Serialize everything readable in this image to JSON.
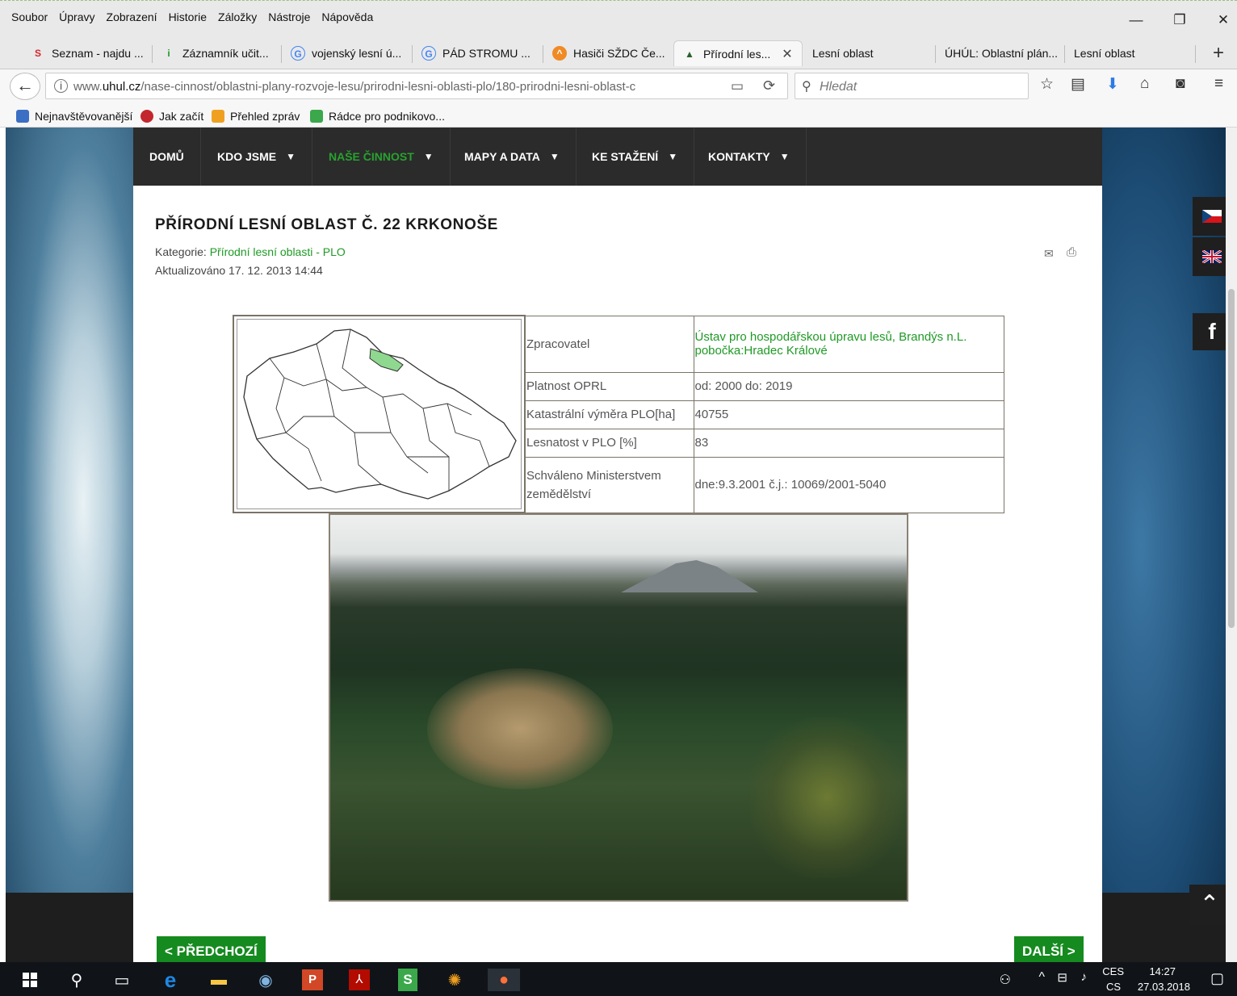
{
  "menubar": {
    "items": [
      "Soubor",
      "Úpravy",
      "Zobrazení",
      "Historie",
      "Záložky",
      "Nástroje",
      "Nápověda"
    ]
  },
  "tabs": [
    {
      "label": "Seznam - najdu ...",
      "icon": "seznam-icon",
      "color": "#d9262f",
      "glyph": "S"
    },
    {
      "label": "Záznamník učit...",
      "icon": "zaznamnik-icon",
      "color": "#1e9c2e",
      "glyph": "i"
    },
    {
      "label": "vojenský lesní ú...",
      "icon": "google-icon",
      "color": "#4285f4",
      "glyph": "G"
    },
    {
      "label": "PÁD STROMU ...",
      "icon": "google-icon",
      "color": "#4285f4",
      "glyph": "G"
    },
    {
      "label": "Hasiči SŽDC Če...",
      "icon": "fire-icon",
      "color": "#f08a24",
      "glyph": "^"
    },
    {
      "label": "Přírodní les...",
      "icon": "tree-icon",
      "color": "#2c5f2d",
      "glyph": "▲"
    },
    {
      "label": "Lesní oblast",
      "icon": "",
      "color": "",
      "glyph": ""
    },
    {
      "label": "ÚHÚL: Oblastní plán...",
      "icon": "",
      "color": "",
      "glyph": ""
    },
    {
      "label": "Lesní oblast",
      "icon": "",
      "color": "",
      "glyph": ""
    }
  ],
  "address": {
    "url_prefix": "www.",
    "url_domain": "uhul.cz",
    "url_path": "/nase-cinnost/oblastni-plany-rozvoje-lesu/prirodni-lesni-oblasti-plo/180-prirodni-lesni-oblast-c",
    "search_placeholder": "Hledat"
  },
  "bookmarks": [
    {
      "label": "Nejnavštěvovanější",
      "color": "#3a6fc4"
    },
    {
      "label": "Jak začít",
      "color": "#c4262e"
    },
    {
      "label": "Přehled zpráv",
      "color": "#f0a020"
    },
    {
      "label": "Rádce pro podnikovo...",
      "color": "#3aa84b"
    }
  ],
  "site_nav": [
    {
      "label": "DOMŮ",
      "has_dropdown": false
    },
    {
      "label": "KDO JSME",
      "has_dropdown": true
    },
    {
      "label": "NAŠE ČINNOST",
      "has_dropdown": true,
      "active": true
    },
    {
      "label": "MAPY A DATA",
      "has_dropdown": true
    },
    {
      "label": "KE STAŽENÍ",
      "has_dropdown": true
    },
    {
      "label": "KONTAKTY",
      "has_dropdown": true
    }
  ],
  "article": {
    "title": "PŘÍRODNÍ LESNÍ OBLAST Č. 22 KRKONOŠE",
    "category_label": "Kategorie:",
    "category_link": "Přírodní lesní oblasti - PLO",
    "updated": "Aktualizováno 17. 12. 2013 14:44"
  },
  "info_table": [
    {
      "label": "Zpracovatel",
      "value": "Ústav pro hospodářskou úpravu lesů, Brandýs n.L. pobočka:Hradec Králové",
      "link": true
    },
    {
      "label": "Platnost OPRL",
      "value": "od: 2000 do: 2019",
      "link": false
    },
    {
      "label": "Katastrální výměra PLO[ha]",
      "value": "40755",
      "link": false
    },
    {
      "label": "Lesnatost v PLO [%]",
      "value": "83",
      "link": false
    },
    {
      "label": "Schváleno Ministerstvem zemědělství",
      "value": "dne:9.3.2001 č.j.: 10069/2001-5040",
      "link": false
    }
  ],
  "pager": {
    "prev": "< PŘEDCHOZÍ",
    "next": "DALŠÍ >"
  },
  "social": {
    "facebook": "f"
  },
  "taskbar": {
    "lang_top": "CES",
    "lang_bottom": "CS",
    "time": "14:27",
    "date": "27.03.2018"
  },
  "colors": {
    "accent_green": "#1f9a25",
    "nav_dark": "#2b2b2b",
    "button_green": "#158a1f"
  }
}
